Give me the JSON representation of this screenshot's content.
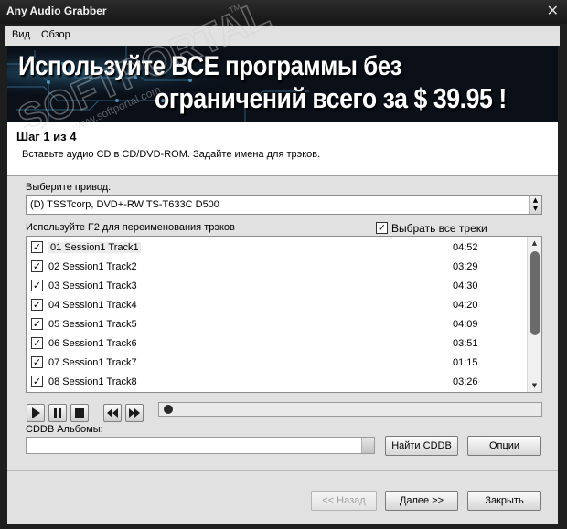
{
  "window": {
    "title": "Any Audio Grabber",
    "close_glyph": "✕"
  },
  "menu": {
    "items": [
      "Вид",
      "Обзор"
    ]
  },
  "banner": {
    "line1": "Используйте ВСЕ программы без",
    "line2": "ограничений всего за  $ 39.95 !"
  },
  "watermark": {
    "text": "SOFTPORTAL",
    "url": "www.softportal.com",
    "tm": "TM"
  },
  "step": {
    "heading": "Шаг 1 из 4",
    "description": "Вставьте аудио CD в CD/DVD-ROM. Задайте имена для трэков."
  },
  "drive": {
    "label": "Выберите привод:",
    "selected": "(D) TSSTcorp, DVD+-RW TS-T633C  D500"
  },
  "tracks": {
    "hint": "Используйте F2 для переименования трэков",
    "select_all_label": "Выбрать все треки",
    "select_all_checked": true,
    "items": [
      {
        "name": "01 Session1 Track1",
        "duration": "04:52",
        "checked": true
      },
      {
        "name": "02 Session1 Track2",
        "duration": "03:29",
        "checked": true
      },
      {
        "name": "03 Session1 Track3",
        "duration": "04:30",
        "checked": true
      },
      {
        "name": "04 Session1 Track4",
        "duration": "04:20",
        "checked": true
      },
      {
        "name": "05 Session1 Track5",
        "duration": "04:09",
        "checked": true
      },
      {
        "name": "06 Session1 Track6",
        "duration": "03:51",
        "checked": true
      },
      {
        "name": "07 Session1 Track7",
        "duration": "01:15",
        "checked": true
      },
      {
        "name": "08 Session1 Track8",
        "duration": "03:26",
        "checked": true
      }
    ]
  },
  "player": {
    "buttons": [
      "play-icon",
      "pause-icon",
      "stop-icon",
      "rewind-icon",
      "fast-forward-icon"
    ],
    "seek_position": 0
  },
  "cddb": {
    "label": "CDDB Альбомы:",
    "find_button": "Найти CDDB",
    "options_button": "Опции"
  },
  "footer": {
    "back_button": "<< Назад",
    "next_button": "Далее >>",
    "close_button": "Закрыть"
  },
  "colors": {
    "window_bg": "#1e1e1e",
    "panel_bg": "#e1e1e1",
    "banner_bg": "#0a0f18"
  }
}
